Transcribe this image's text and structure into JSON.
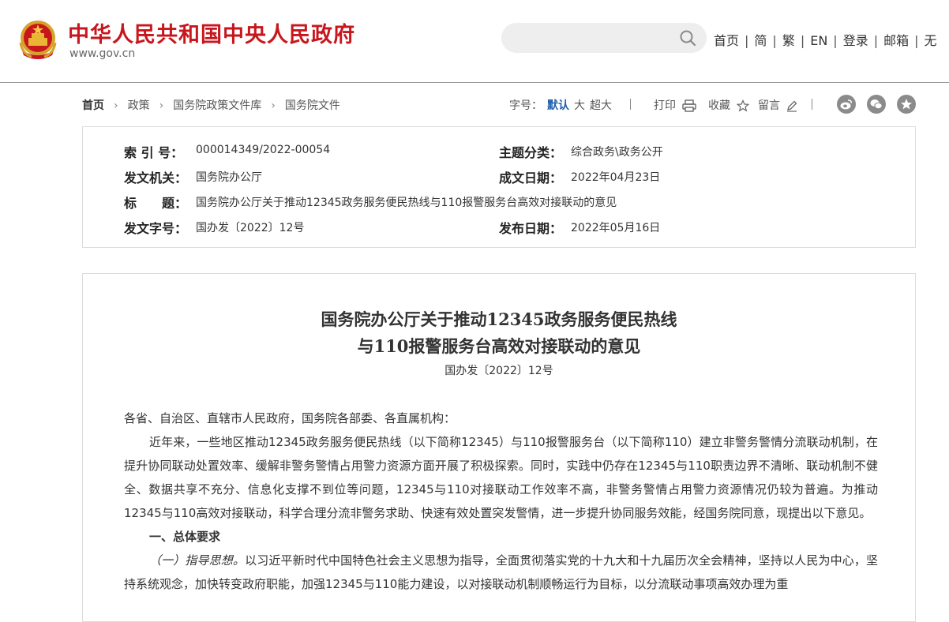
{
  "header": {
    "site_title": "中华人民共和国中央人民政府",
    "site_domain": "www.gov.cn",
    "search": {
      "placeholder": "",
      "icon": "search-icon"
    },
    "nav": [
      {
        "label": "首页"
      },
      {
        "label": "简"
      },
      {
        "label": "繁"
      },
      {
        "label": "EN"
      },
      {
        "label": "登录"
      },
      {
        "label": "邮箱"
      },
      {
        "label": "无"
      }
    ],
    "brand_color": "#c8161d"
  },
  "breadcrumb": [
    "首页",
    "政策",
    "国务院政策文件库",
    "国务院文件"
  ],
  "tools": {
    "font_size_label": "字号：",
    "font_sizes": [
      "默认",
      "大",
      "超大"
    ],
    "print": "打印",
    "favorite": "收藏",
    "comment": "留言",
    "share": [
      "weibo-icon",
      "wechat-icon",
      "favorite-star-icon"
    ]
  },
  "meta": {
    "index_label": "索 引 号：",
    "index_value": "000014349/2022-00054",
    "topic_label": "主题分类：",
    "topic_value": "综合政务\\政务公开",
    "issuer_label": "发文机关：",
    "issuer_value": "国务院办公厅",
    "date_written_label": "成文日期：",
    "date_written_value": "2022年04月23日",
    "title_label": "标　　题：",
    "title_value": "国务院办公厅关于推动12345政务服务便民热线与110报警服务台高效对接联动的意见",
    "doc_no_label": "发文字号：",
    "doc_no_value": "国办发〔2022〕12号",
    "publish_label": "发布日期：",
    "publish_value": "2022年05月16日"
  },
  "article": {
    "title_line1": "国务院办公厅关于推动12345政务服务便民热线",
    "title_line2": "与110报警服务台高效对接联动的意见",
    "doc_number": "国办发〔2022〕12号",
    "salutation": "各省、自治区、直辖市人民政府，国务院各部委、各直属机构：",
    "intro": "近年来，一些地区推动12345政务服务便民热线（以下简称12345）与110报警服务台（以下简称110）建立非警务警情分流联动机制，在提升协同联动处置效率、缓解非警务警情占用警力资源方面开展了积极探索。同时，实践中仍存在12345与110职责边界不清晰、联动机制不健全、数据共享不充分、信息化支撑不到位等问题，12345与110对接联动工作效率不高，非警务警情占用警力资源情况仍较为普遍。为推动12345与110高效对接联动，科学合理分流非警务求助、快速有效处置突发警情，进一步提升协同服务效能，经国务院同意，现提出以下意见。",
    "section1": "一、总体要求",
    "sub1_label": "（一）指导思想。",
    "sub1_text": "以习近平新时代中国特色社会主义思想为指导，全面贯彻落实党的十九大和十九届历次全会精神，坚持以人民为中心，坚持系统观念，加快转变政府职能，加强12345与110能力建设，以对接联动机制顺畅运行为目标，以分流联动事项高效办理为重"
  }
}
